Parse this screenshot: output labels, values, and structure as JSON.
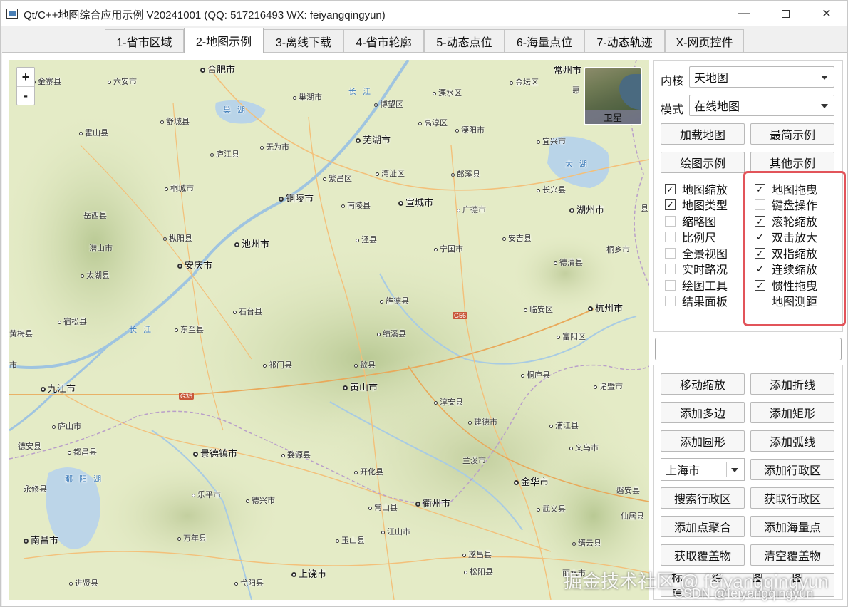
{
  "window": {
    "title": "Qt/C++地图综合应用示例 V20241001 (QQ: 517216493 WX: feiyangqingyun)"
  },
  "tabs": [
    {
      "label": "1-省市区域",
      "active": false
    },
    {
      "label": "2-地图示例",
      "active": true
    },
    {
      "label": "3-离线下载",
      "active": false
    },
    {
      "label": "4-省市轮廓",
      "active": false
    },
    {
      "label": "5-动态点位",
      "active": false
    },
    {
      "label": "6-海量点位",
      "active": false
    },
    {
      "label": "7-动态轨迹",
      "active": false
    },
    {
      "label": "X-网页控件",
      "active": false
    }
  ],
  "map": {
    "zoom_in": "+",
    "zoom_out": "-",
    "layer_switch_label": "卫星",
    "labels": {
      "hefei": "合肥市",
      "jinzhai": "金寨县",
      "liuan": "六安市",
      "chaohu_city": "巢湖市",
      "chaohu_lake": "巢 湖",
      "shucheng": "舒城县",
      "huoshan": "霍山县",
      "lujiang": "庐江县",
      "wuwei": "无为市",
      "wuhu": "芜湖市",
      "bowang": "博望区",
      "lishui": "溧水区",
      "jintan": "金坛区",
      "changzhou": "常州市",
      "gaochun": "高淳区",
      "liyang": "溧阳市",
      "yixing": "宜兴市",
      "taihu": "太 湖",
      "changxing": "长兴县",
      "huzhou": "湖州市",
      "langxi": "郎溪县",
      "wanzhi": "湾沚区",
      "fanchang": "繁昌区",
      "tongcheng": "桐城市",
      "yuexi": "岳西县",
      "tongling": "铜陵市",
      "nanling": "南陵县",
      "xuancheng": "宣城市",
      "guangde": "广德市",
      "anji": "安吉县",
      "zongyang": "枞阳县",
      "qianshan": "潜山市",
      "chizhou": "池州市",
      "jingxian": "泾县",
      "ningguo": "宁国市",
      "deqing": "德清县",
      "tonglu_east": "桐乡市",
      "anqing": "安庆市",
      "taihu_county": "太湖县",
      "susong": "宿松县",
      "shitai": "石台县",
      "jingde": "旌德县",
      "linan": "临安区",
      "hangzhou": "杭州市",
      "dongzhi": "东至县",
      "huangmei": "黄梅县",
      "jixi": "绩溪县",
      "fuyang": "富阳区",
      "qimen": "祁门县",
      "shexian": "歙县",
      "tonglu": "桐庐县",
      "jiujiang": "九江市",
      "huangshan": "黄山市",
      "zhuji": "诸暨市",
      "chunan": "淳安县",
      "lushan": "庐山市",
      "jiande": "建德市",
      "pujiang": "浦江县",
      "dean": "德安县",
      "duchang": "都昌县",
      "jingdezhen": "景德镇市",
      "wuyuan": "婺源县",
      "lanxi": "兰溪市",
      "yiwu": "义乌市",
      "poyang_lake": "鄱 阳 湖",
      "kaihua": "开化县",
      "yongxiu": "永修县",
      "leping": "乐平市",
      "dexing": "德兴市",
      "jinhua": "金华市",
      "panan": "磐安县",
      "changshan": "常山县",
      "quzhou": "衢州市",
      "wuyi": "武义县",
      "xianju": "仙居县",
      "wannian": "万年县",
      "yushan": "玉山县",
      "jiangshan": "江山市",
      "jinyun": "缙云县",
      "nanchang": "南昌市",
      "suichang": "遂昌县",
      "shangrao": "上饶市",
      "lishui_zj": "丽水市",
      "songyang": "松阳县",
      "jinxian": "进贤县",
      "yiyang": "弋阳县",
      "changjiang_1": "长 江",
      "changjiang_2": "长 江",
      "changjiang_3": "长 江",
      "ezhou": "市",
      "nanlingx": "县",
      "hui": "惠",
      "hwy_g56": "G56",
      "hwy_g35": "G35"
    }
  },
  "panel": {
    "kernel_label": "内核",
    "kernel_value": "天地图",
    "mode_label": "模式",
    "mode_value": "在线地图",
    "buttons_top": [
      "加载地图",
      "最简示例",
      "绘图示例",
      "其他示例"
    ],
    "checks_left": [
      {
        "label": "地图缩放",
        "checked": true
      },
      {
        "label": "地图类型",
        "checked": true
      },
      {
        "label": "缩略图",
        "checked": false
      },
      {
        "label": "比例尺",
        "checked": false
      },
      {
        "label": "全景视图",
        "checked": false
      },
      {
        "label": "实时路况",
        "checked": false
      },
      {
        "label": "绘图工具",
        "checked": false
      },
      {
        "label": "结果面板",
        "checked": false
      }
    ],
    "checks_right": [
      {
        "label": "地图拖曳",
        "checked": true
      },
      {
        "label": "键盘操作",
        "checked": false
      },
      {
        "label": "滚轮缩放",
        "checked": true
      },
      {
        "label": "双击放大",
        "checked": true
      },
      {
        "label": "双指缩放",
        "checked": true
      },
      {
        "label": "连续缩放",
        "checked": true
      },
      {
        "label": "惯性拖曳",
        "checked": true
      },
      {
        "label": "地图测距",
        "checked": false
      }
    ],
    "check_mark": "✓",
    "text_input_value": "",
    "buttons_bottom": [
      "移动缩放",
      "添加折线",
      "添加多边",
      "添加矩形",
      "添加圆形",
      "添加弧线"
    ],
    "city_combo_value": "上海市",
    "add_district": "添加行政区",
    "buttons_bottom2": [
      "搜索行政区",
      "获取行政区",
      "添加点聚合",
      "添加海量点",
      "获取覆盖物",
      "清空覆盖物"
    ],
    "partial_last_row": "标 绘 图 图 层"
  },
  "watermark": {
    "line1": "掘金技术社区 @ feiyangqingyun",
    "line2": "CSDN @feiyangqingyun"
  },
  "colors": {
    "highlight_border": "#e2545a",
    "map_base": "#e6ecc8",
    "water": "#3a79b8",
    "highway": "#c9573a"
  }
}
